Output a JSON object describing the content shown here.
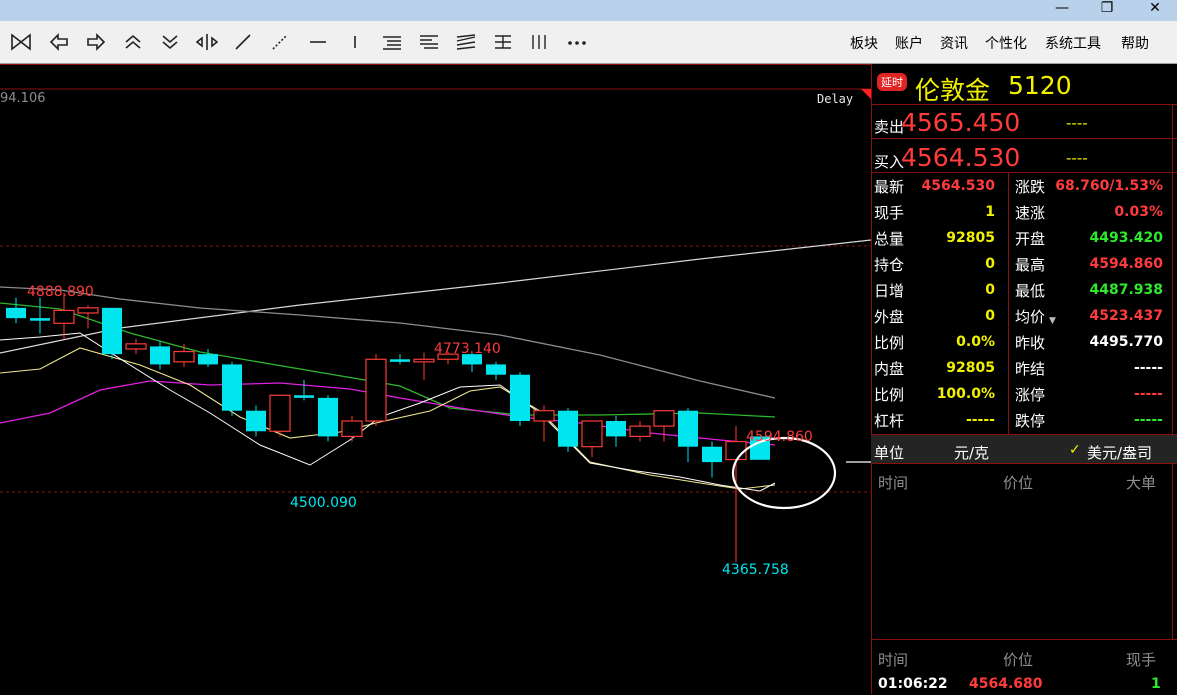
{
  "window": {
    "minimize": "—",
    "maximize": "❐",
    "close": "✕"
  },
  "toolbar": {
    "icons": [
      "collapse-icon",
      "arrow-left-icon",
      "arrow-right-icon",
      "double-up-icon",
      "double-down-icon",
      "split-icon",
      "line-draw-icon",
      "dotted-line-icon",
      "horizontal-line-icon",
      "vertical-line-icon",
      "channel-icon",
      "fib-icon",
      "fan-icon",
      "gann-icon",
      "cycle-icon",
      "more-icon"
    ],
    "menu": [
      "板块",
      "账户",
      "资讯",
      "个性化",
      "系统工具",
      "帮助"
    ]
  },
  "chart": {
    "top_price": "94.106",
    "mode": "Delay",
    "annotations": {
      "high_left": "4888.890",
      "high_mid": "4773.140",
      "low_mid": "4500.090",
      "high_right": "4594.860",
      "low_right": "4365.758"
    },
    "chart_data": {
      "type": "candlestick",
      "ohlc": [
        [
          4860,
          4880,
          4830,
          4840
        ],
        [
          4840,
          4880,
          4810,
          4835
        ],
        [
          4830,
          4888.89,
          4800,
          4855
        ],
        [
          4850,
          4865,
          4820,
          4860
        ],
        [
          4860,
          4860,
          4760,
          4770
        ],
        [
          4780,
          4800,
          4770,
          4790
        ],
        [
          4785,
          4795,
          4740,
          4750
        ],
        [
          4755,
          4790,
          4745,
          4775
        ],
        [
          4770,
          4780,
          4745,
          4750
        ],
        [
          4750,
          4755,
          4650,
          4660
        ],
        [
          4660,
          4670,
          4610,
          4620
        ],
        [
          4620,
          4690,
          4610,
          4690
        ],
        [
          4690,
          4720,
          4680,
          4685
        ],
        [
          4685,
          4690,
          4600,
          4610
        ],
        [
          4610,
          4650,
          4600,
          4640
        ],
        [
          4640,
          4770,
          4630,
          4760
        ],
        [
          4760,
          4770,
          4750,
          4755
        ],
        [
          4755,
          4773.14,
          4720,
          4760
        ],
        [
          4760,
          4775,
          4750,
          4770
        ],
        [
          4770,
          4772,
          4735,
          4750
        ],
        [
          4750,
          4755,
          4720,
          4730
        ],
        [
          4730,
          4735,
          4630,
          4640
        ],
        [
          4640,
          4670,
          4600,
          4660
        ],
        [
          4660,
          4665,
          4580,
          4590
        ],
        [
          4590,
          4640,
          4570,
          4640
        ],
        [
          4640,
          4650,
          4590,
          4610
        ],
        [
          4610,
          4640,
          4600,
          4630
        ],
        [
          4630,
          4660,
          4600,
          4660
        ],
        [
          4660,
          4665,
          4560,
          4590
        ],
        [
          4590,
          4600,
          4530,
          4560
        ],
        [
          4565,
          4630,
          4365.758,
          4600
        ],
        [
          4610,
          4594.86,
          4605,
          4564.53
        ]
      ],
      "xlabel": "",
      "ylabel": ""
    }
  },
  "panel": {
    "badge": "延时",
    "name": "伦敦金",
    "code": "5120",
    "sell_label": "卖出",
    "sell_price": "4565.450",
    "sell_vol": "----",
    "buy_label": "买入",
    "buy_price": "4564.530",
    "buy_vol": "----",
    "left_rows": [
      {
        "label": "最新",
        "value": "4564.530",
        "color": "red"
      },
      {
        "label": "现手",
        "value": "1",
        "color": "yel"
      },
      {
        "label": "总量",
        "value": "92805",
        "color": "yel"
      },
      {
        "label": "持仓",
        "value": "0",
        "color": "yel"
      },
      {
        "label": "日增",
        "value": "0",
        "color": "yel"
      },
      {
        "label": "外盘",
        "value": "0",
        "color": "yel"
      },
      {
        "label": "比例",
        "value": "0.0%",
        "color": "yel"
      },
      {
        "label": "内盘",
        "value": "92805",
        "color": "yel"
      },
      {
        "label": "比例",
        "value": "100.0%",
        "color": "yel"
      },
      {
        "label": "杠杆",
        "value": "-----",
        "color": "yel"
      }
    ],
    "right_rows": [
      {
        "label": "涨跌",
        "value": "68.760/1.53%",
        "color": "red"
      },
      {
        "label": "速涨",
        "value": "0.03%",
        "color": "red"
      },
      {
        "label": "开盘",
        "value": "4493.420",
        "color": "grn"
      },
      {
        "label": "最高",
        "value": "4594.860",
        "color": "red"
      },
      {
        "label": "最低",
        "value": "4487.938",
        "color": "grn"
      },
      {
        "label": "均价",
        "value": "4523.437",
        "color": "red"
      },
      {
        "label": "昨收",
        "value": "4495.770",
        "color": "wht"
      },
      {
        "label": "昨结",
        "value": "-----",
        "color": "wht"
      },
      {
        "label": "涨停",
        "value": "-----",
        "color": "red"
      },
      {
        "label": "跌停",
        "value": "-----",
        "color": "grn"
      }
    ],
    "unit_label": "单位",
    "unit_value": "元/克",
    "currency": "美元/盎司",
    "table1_headers": [
      "时间",
      "价位",
      "大单"
    ],
    "table2_headers": [
      "时间",
      "价位",
      "现手"
    ],
    "tick": {
      "time": "01:06:22",
      "price": "4564.680",
      "qty": "1"
    }
  }
}
